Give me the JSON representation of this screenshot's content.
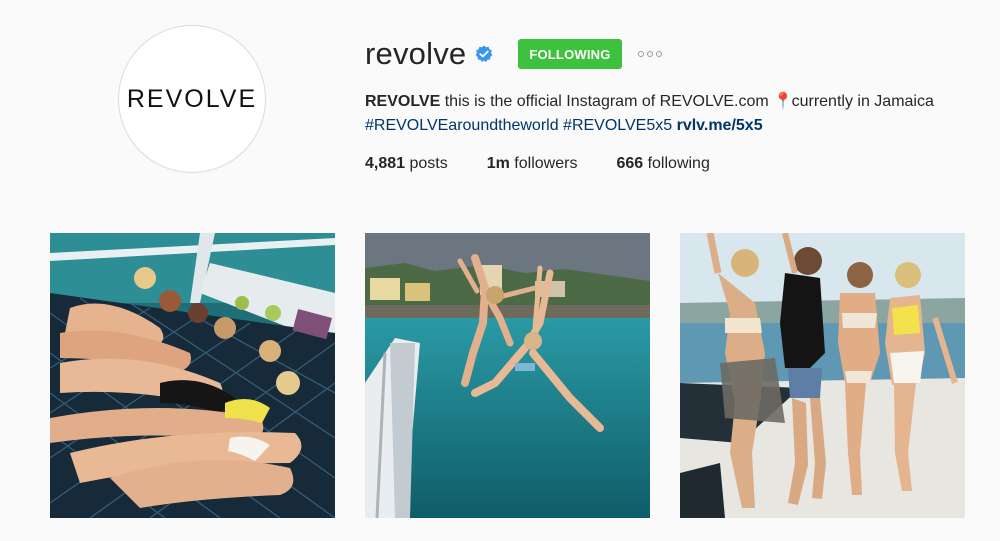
{
  "profile": {
    "avatar_text": "REVOLVE",
    "username": "revolve",
    "follow_button": "FOLLOWING",
    "verified_icon": "verified-badge-icon",
    "more_icon": "more-options-icon",
    "bio": {
      "name": "REVOLVE",
      "text": " this is the official Instagram of REVOLVE.com ",
      "pin_icon": "📍",
      "location": " currently in Jamaica",
      "hashtag1": "#REVOLVEaroundtheworld",
      "hashtag2": "#REVOLVE5x5",
      "link": "rvlv.me/5x5"
    },
    "stats": {
      "posts_count": "4,881",
      "posts_label": " posts",
      "followers_count": "1m",
      "followers_label": " followers",
      "following_count": "666",
      "following_label": " following"
    }
  },
  "colors": {
    "follow_button": "#3ec13e",
    "verified": "#3897f0",
    "link": "#003569"
  },
  "photos": [
    "photo-group-on-boat-net",
    "photo-jumping-into-sea",
    "photo-group-posing-on-deck"
  ]
}
